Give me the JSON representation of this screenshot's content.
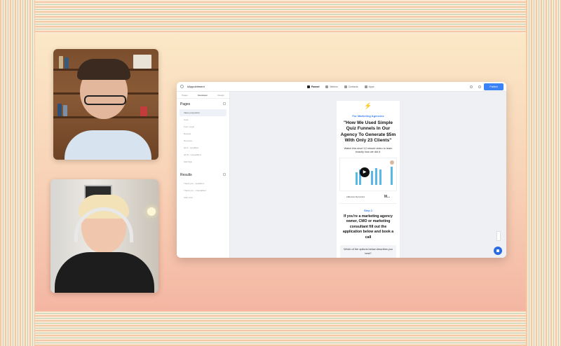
{
  "app": {
    "name": "#Appointment",
    "nav": [
      "Funnel",
      "Metrics",
      "Contacts",
      "Apps"
    ],
    "publish_label": "Publish"
  },
  "sidebar": {
    "tabs": [
      "Pages",
      "Developer",
      "Design"
    ],
    "pages_heading": "Pages",
    "pages": [
      "Value proposition",
      "Goal",
      "Form Logic",
      "Booked",
      "Revenue",
      "Q2 A - Qualified",
      "Q2 B - Unqualified",
      "Self-Sign"
    ],
    "results_heading": "Results",
    "results": [
      "Thank you - Qualified",
      "Thank you - Unqualified",
      "Add more"
    ]
  },
  "preview": {
    "kicker": "For Marketing Agencies",
    "headline": "\"How We Used Simple Quiz Funnels In Our Agency To Generate $5m With Only 23 Clients\"",
    "subtext": "Watch this short 12 minute video to learn exactly how we did it.",
    "logos": [
      "Adhesive Dynamics",
      "M..."
    ],
    "step_label": "Step 2",
    "step_headline": "If you're a marketing agency owner, CMO or marketing consultant fill out the application below and book a call",
    "question": "Which of the options below describes you best?"
  },
  "colors": {
    "accent": "#3b82f6",
    "stage_top": "#fbe8c6",
    "stage_bottom": "#f4b6a2"
  },
  "icons": {
    "bolt": "⚡",
    "play": "▶"
  }
}
